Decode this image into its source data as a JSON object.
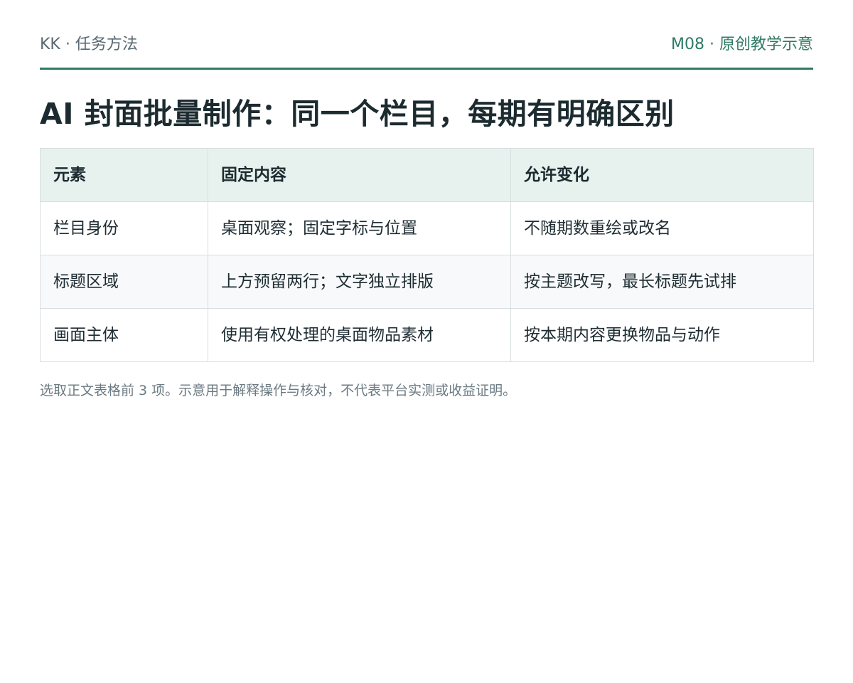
{
  "header": {
    "brand": "KK · 任务方法",
    "module": "M08 · 原创教学示意"
  },
  "title": "AI 封面批量制作：同一个栏目，每期有明确区别",
  "table": {
    "columns": [
      "元素",
      "固定内容",
      "允许变化"
    ],
    "rows": [
      [
        "栏目身份",
        "桌面观察；固定字标与位置",
        "不随期数重绘或改名"
      ],
      [
        "标题区域",
        "上方预留两行；文字独立排版",
        "按主题改写，最长标题先试排"
      ],
      [
        "画面主体",
        "使用有权处理的桌面物品素材",
        "按本期内容更换物品与动作"
      ]
    ]
  },
  "note": "选取正文表格前 3 项。示意用于解释操作与核对，不代表平台实测或收益证明。",
  "colors": {
    "accent": "#2f7a64",
    "header_bg": "#e7f2ee",
    "alt_row_bg": "#f7f9fa",
    "border": "#d8dee0"
  }
}
